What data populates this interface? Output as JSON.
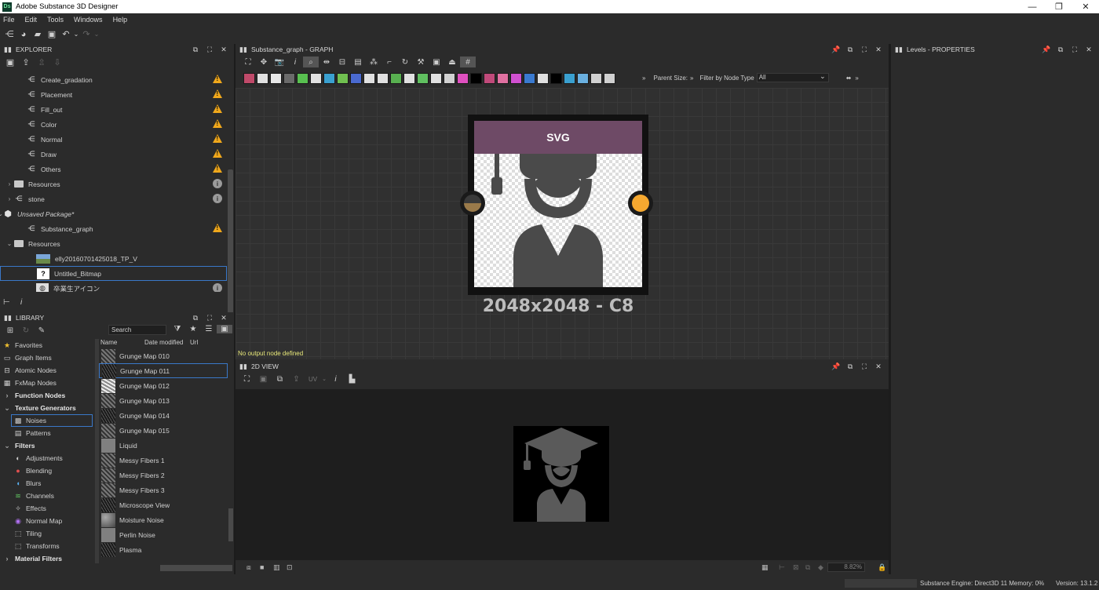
{
  "window": {
    "title": "Adobe Substance 3D Designer",
    "logo": "Ds",
    "controls": [
      "—",
      "❐",
      "✕"
    ]
  },
  "menu": [
    "File",
    "Edit",
    "Tools",
    "Windows",
    "Help"
  ],
  "explorer": {
    "title": "EXPLORER",
    "tree": [
      {
        "label": "Create_gradation",
        "indent": 34,
        "type": "graph",
        "badge": "warn"
      },
      {
        "label": "Placement",
        "indent": 34,
        "type": "graph",
        "badge": "warn"
      },
      {
        "label": "Fill_out",
        "indent": 34,
        "type": "graph",
        "badge": "warn"
      },
      {
        "label": "Color",
        "indent": 34,
        "type": "graph",
        "badge": "warn"
      },
      {
        "label": "Normal",
        "indent": 34,
        "type": "graph",
        "badge": "warn"
      },
      {
        "label": "Draw",
        "indent": 34,
        "type": "graph",
        "badge": "warn"
      },
      {
        "label": "Others",
        "indent": 34,
        "type": "graph",
        "badge": "warn"
      },
      {
        "label": "Resources",
        "indent": 18,
        "type": "folder",
        "badge": "info",
        "arrow": "›"
      },
      {
        "label": "stone",
        "indent": 18,
        "type": "graph",
        "badge": "info",
        "arrow": "›"
      },
      {
        "label": "Unsaved Package*",
        "indent": 4,
        "type": "package",
        "badge": "",
        "arrow": "⌄",
        "italic": true
      },
      {
        "label": "Substance_graph",
        "indent": 34,
        "type": "graph",
        "badge": "warn"
      },
      {
        "label": "Resources",
        "indent": 18,
        "type": "folder",
        "badge": "",
        "arrow": "⌄"
      },
      {
        "label": "elly20160701425018_TP_V",
        "indent": 46,
        "type": "image",
        "badge": ""
      },
      {
        "label": "Untitled_Bitmap",
        "indent": 46,
        "type": "bitmap",
        "badge": "",
        "selected": true
      },
      {
        "label": "卒業生アイコン",
        "indent": 46,
        "type": "svg",
        "badge": "info"
      }
    ]
  },
  "library": {
    "title": "LIBRARY",
    "search_placeholder": "Search",
    "columns": [
      "Name",
      "Date modified",
      "Url"
    ],
    "categories": [
      {
        "label": "Favorites",
        "icon": "★",
        "color": "#f0c030",
        "indent": 4,
        "bold": false
      },
      {
        "label": "Graph Items",
        "icon": "▭",
        "color": "#cccccc",
        "indent": 4,
        "bold": false
      },
      {
        "label": "Atomic Nodes",
        "icon": "⊟",
        "color": "#cccccc",
        "indent": 4,
        "bold": false
      },
      {
        "label": "FxMap Nodes",
        "icon": "▦",
        "color": "#cccccc",
        "indent": 4,
        "bold": false
      },
      {
        "label": "Function Nodes",
        "icon": "›",
        "color": "#aaaaaa",
        "indent": 4,
        "bold": true
      },
      {
        "label": "Texture Generators",
        "icon": "⌄",
        "color": "#aaaaaa",
        "indent": 4,
        "bold": true
      },
      {
        "label": "Noises",
        "icon": "▩",
        "color": "#cccccc",
        "indent": 18,
        "bold": false,
        "selected": true
      },
      {
        "label": "Patterns",
        "icon": "▤",
        "color": "#cccccc",
        "indent": 18,
        "bold": false
      },
      {
        "label": "Filters",
        "icon": "⌄",
        "color": "#aaaaaa",
        "indent": 4,
        "bold": true
      },
      {
        "label": "Adjustments",
        "icon": "◐",
        "color": "#cccccc",
        "indent": 18,
        "bold": false
      },
      {
        "label": "Blending",
        "icon": "●",
        "color": "#e05050",
        "indent": 18,
        "bold": false
      },
      {
        "label": "Blurs",
        "icon": "◖",
        "color": "#5ab0f0",
        "indent": 18,
        "bold": false
      },
      {
        "label": "Channels",
        "icon": "≋",
        "color": "#60c060",
        "indent": 18,
        "bold": false
      },
      {
        "label": "Effects",
        "icon": "✧",
        "color": "#cccccc",
        "indent": 18,
        "bold": false
      },
      {
        "label": "Normal Map",
        "icon": "◉",
        "color": "#b070f0",
        "indent": 18,
        "bold": false
      },
      {
        "label": "Tiling",
        "icon": "⬚",
        "color": "#cccccc",
        "indent": 18,
        "bold": false
      },
      {
        "label": "Transforms",
        "icon": "⬚",
        "color": "#cccccc",
        "indent": 18,
        "bold": false
      },
      {
        "label": "Material Filters",
        "icon": "›",
        "color": "#aaaaaa",
        "indent": 4,
        "bold": true
      }
    ],
    "items": [
      {
        "label": "Grunge Map 010",
        "thumb": ""
      },
      {
        "label": "Grunge Map 011",
        "thumb": "dark",
        "selected": true
      },
      {
        "label": "Grunge Map 012",
        "thumb": "light"
      },
      {
        "label": "Grunge Map 013",
        "thumb": ""
      },
      {
        "label": "Grunge Map 014",
        "thumb": "dark"
      },
      {
        "label": "Grunge Map 015",
        "thumb": ""
      },
      {
        "label": "Liquid",
        "thumb": "gray"
      },
      {
        "label": "Messy Fibers 1",
        "thumb": ""
      },
      {
        "label": "Messy Fibers 2",
        "thumb": ""
      },
      {
        "label": "Messy Fibers 3",
        "thumb": ""
      },
      {
        "label": "Microscope View",
        "thumb": "dark"
      },
      {
        "label": "Moisture Noise",
        "thumb": "noise"
      },
      {
        "label": "Perlin Noise",
        "thumb": "gray"
      },
      {
        "label": "Plasma",
        "thumb": "dark"
      }
    ]
  },
  "graph": {
    "title": "Substance_graph - GRAPH",
    "parent_size_label": "Parent Size:",
    "filter_label": "Filter by Node Type",
    "filter_value": "All",
    "node_title": "SVG",
    "node_resolution": "2048x2048 - C8",
    "warning": "No output node defined",
    "palette_colors": [
      "#c04a6a",
      "#e0e0e0",
      "#e8e8e8",
      "#6a6a6a",
      "#58c050",
      "#e0e0e0",
      "#3aa0d0",
      "#70c050",
      "#4a6ad0",
      "#e0e0e0",
      "#e0e0e0",
      "#58b050",
      "#e0e0e0",
      "#60c060",
      "#e0e0e0",
      "#d0d0d0",
      "#e050c0",
      "#000000",
      "#c04a7a",
      "#e070a0",
      "#d050d0",
      "#3a7ad0",
      "#e0e0e0",
      "#000000",
      "#3aa0d0",
      "#6ab0e0",
      "#d0d0d0",
      "#d0d0d0"
    ]
  },
  "view2d": {
    "title": "2D VIEW",
    "uv_label": "UV",
    "zoom": "8.82%"
  },
  "properties": {
    "title": "Levels - PROPERTIES"
  },
  "status": {
    "engine": "Substance Engine: Direct3D 11  Memory: 0%",
    "version": "Version: 13.1.2"
  }
}
